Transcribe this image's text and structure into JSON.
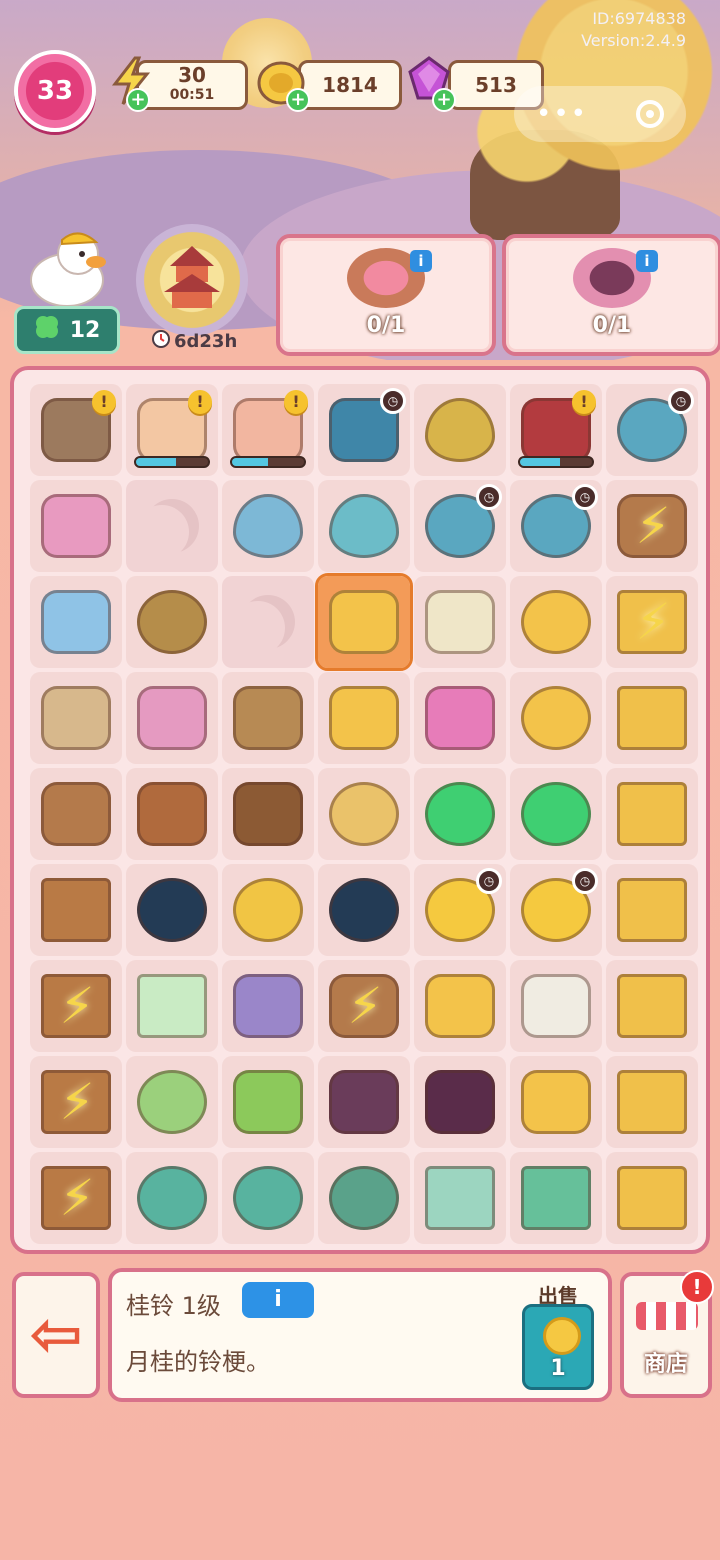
{
  "system": {
    "id": "ID:6974838",
    "version": "Version:2.4.9"
  },
  "player": {
    "level": "33"
  },
  "resources": {
    "energy": {
      "value": "30",
      "timer": "00:51"
    },
    "coins": {
      "value": "1814"
    },
    "gems": {
      "value": "513"
    }
  },
  "clovers": "12",
  "event": {
    "timer": "6d23h"
  },
  "orders": [
    {
      "count": "0/1"
    },
    {
      "count": "0/1"
    }
  ],
  "board": {
    "cells": [
      {
        "icon": "rabbit-mill",
        "type": "item",
        "color": "#9c7a5e",
        "alert": true
      },
      {
        "icon": "bunny-cook",
        "type": "item",
        "color": "#f3c7a3",
        "alert": true,
        "progress": 0.55
      },
      {
        "icon": "bunny-painter",
        "type": "item",
        "color": "#f2b6a0",
        "alert": true,
        "progress": 0.5
      },
      {
        "icon": "pavilion",
        "type": "item",
        "color": "#3f86a8",
        "clock": true
      },
      {
        "icon": "osmanthus-tree",
        "type": "item",
        "color": "#d8b44a"
      },
      {
        "icon": "red-lantern-house",
        "type": "item",
        "color": "#b33b3f",
        "alert": true,
        "progress": 0.55
      },
      {
        "icon": "moon-tree",
        "type": "item",
        "color": "#5aa7c0",
        "clock": true
      },
      {
        "icon": "slippers",
        "type": "item",
        "color": "#e89ac0"
      },
      {
        "icon": "moon",
        "type": "empty"
      },
      {
        "icon": "sprout-blue",
        "type": "item",
        "color": "#7db8d6"
      },
      {
        "icon": "seedling",
        "type": "item",
        "color": "#6cbcc8"
      },
      {
        "icon": "moon-tree",
        "type": "item",
        "color": "#5aa7c0",
        "clock": true
      },
      {
        "icon": "moon-tree",
        "type": "item",
        "color": "#5aa7c0",
        "clock": true
      },
      {
        "icon": "flower-basket",
        "type": "item",
        "color": "#b47a4b",
        "bolt": true
      },
      {
        "icon": "blue-vase",
        "type": "item",
        "color": "#8fc3e6"
      },
      {
        "icon": "soup-bowl",
        "type": "item",
        "color": "#b58d4a"
      },
      {
        "icon": "moon",
        "type": "empty"
      },
      {
        "icon": "osmanthus-sprig",
        "type": "item",
        "color": "#f3c34a",
        "selected": true
      },
      {
        "icon": "tea-cup",
        "type": "item",
        "color": "#efe6c8"
      },
      {
        "icon": "star-plate",
        "type": "item",
        "color": "#f3c34a"
      },
      {
        "icon": "golden-cabinet",
        "type": "item",
        "color": "#f0c04a",
        "bolt": true
      },
      {
        "icon": "thread-spool",
        "type": "item",
        "color": "#d7b88c"
      },
      {
        "icon": "rabbit-gift",
        "type": "item",
        "color": "#e59ac1"
      },
      {
        "icon": "pinecones",
        "type": "item",
        "color": "#b78a54"
      },
      {
        "icon": "osmanthus-flower",
        "type": "item",
        "color": "#f3c34a"
      },
      {
        "icon": "silk-pouch",
        "type": "item",
        "color": "#e77cb9"
      },
      {
        "icon": "star-bowl",
        "type": "item",
        "color": "#f3c34a"
      },
      {
        "icon": "golden-cabinet",
        "type": "item",
        "color": "#f0c04a"
      },
      {
        "icon": "osmanthus-basket",
        "type": "item",
        "color": "#b47a4b"
      },
      {
        "icon": "wood-pig",
        "type": "item",
        "color": "#b06a3d"
      },
      {
        "icon": "acorn",
        "type": "item",
        "color": "#8c5a34"
      },
      {
        "icon": "mooncake",
        "type": "item",
        "color": "#eac26a"
      },
      {
        "icon": "infinity-gem",
        "type": "item",
        "color": "#3fcf72"
      },
      {
        "icon": "hourglass-gem",
        "type": "item",
        "color": "#3fcf72"
      },
      {
        "icon": "golden-cabinet",
        "type": "item",
        "color": "#f0c04a"
      },
      {
        "icon": "wood-stand",
        "type": "item",
        "color": "#b97a45"
      },
      {
        "icon": "crescent-moon",
        "type": "item",
        "color": "#233b55"
      },
      {
        "icon": "half-moon-cloud",
        "type": "item",
        "color": "#f1c544"
      },
      {
        "icon": "half-moon",
        "type": "item",
        "color": "#233b55"
      },
      {
        "icon": "full-moon",
        "type": "item",
        "color": "#f5c93f",
        "clock": true
      },
      {
        "icon": "full-moon",
        "type": "item",
        "color": "#f5c93f",
        "clock": true
      },
      {
        "icon": "golden-cabinet",
        "type": "item",
        "color": "#f0c04a"
      },
      {
        "icon": "wood-stand",
        "type": "item",
        "color": "#b97a45",
        "bolt": true
      },
      {
        "icon": "jade-die",
        "type": "item",
        "color": "#c9ebc4"
      },
      {
        "icon": "folded-cloth",
        "type": "item",
        "color": "#9a86c9"
      },
      {
        "icon": "flower-basket",
        "type": "item",
        "color": "#b47a4b",
        "bolt": true
      },
      {
        "icon": "osmanthus-bunch",
        "type": "item",
        "color": "#f3c34a"
      },
      {
        "icon": "ice-cone",
        "type": "item",
        "color": "#f0ece2"
      },
      {
        "icon": "golden-cabinet",
        "type": "item",
        "color": "#f0c04a"
      },
      {
        "icon": "wood-stand",
        "type": "item",
        "color": "#b97a45",
        "bolt": true
      },
      {
        "icon": "jade-bowl",
        "type": "item",
        "color": "#9bd07c"
      },
      {
        "icon": "bamboo-cup",
        "type": "item",
        "color": "#8cc95b"
      },
      {
        "icon": "honey-jars",
        "type": "item",
        "color": "#6a3c5a"
      },
      {
        "icon": "potion-bottle",
        "type": "item",
        "color": "#5a2c4a"
      },
      {
        "icon": "star-chest",
        "type": "item",
        "color": "#f3c34a"
      },
      {
        "icon": "golden-cabinet",
        "type": "item",
        "color": "#f0c04a"
      },
      {
        "icon": "wood-stand",
        "type": "item",
        "color": "#b97a45",
        "bolt": true
      },
      {
        "icon": "jade-plate",
        "type": "item",
        "color": "#58b39f"
      },
      {
        "icon": "jade-plate",
        "type": "item",
        "color": "#58b39f"
      },
      {
        "icon": "leaf-plate",
        "type": "item",
        "color": "#5aa28a"
      },
      {
        "icon": "jade-tray",
        "type": "item",
        "color": "#9cd5c0"
      },
      {
        "icon": "jade-box",
        "type": "item",
        "color": "#66c09a"
      },
      {
        "icon": "golden-cabinet",
        "type": "item",
        "color": "#f0c04a"
      }
    ]
  },
  "selected_item": {
    "title": "桂铃 1级",
    "info_label": "i",
    "description": "月桂的铃梗。",
    "sell_label": "出售",
    "sell_price": "1"
  },
  "shop": {
    "label": "商店",
    "badge": "!"
  },
  "colors": {
    "board_border": "#d8718a",
    "accent_blue": "#2d92e6",
    "sell_teal": "#2ba8b5",
    "level_pink": "#e23d7b"
  }
}
